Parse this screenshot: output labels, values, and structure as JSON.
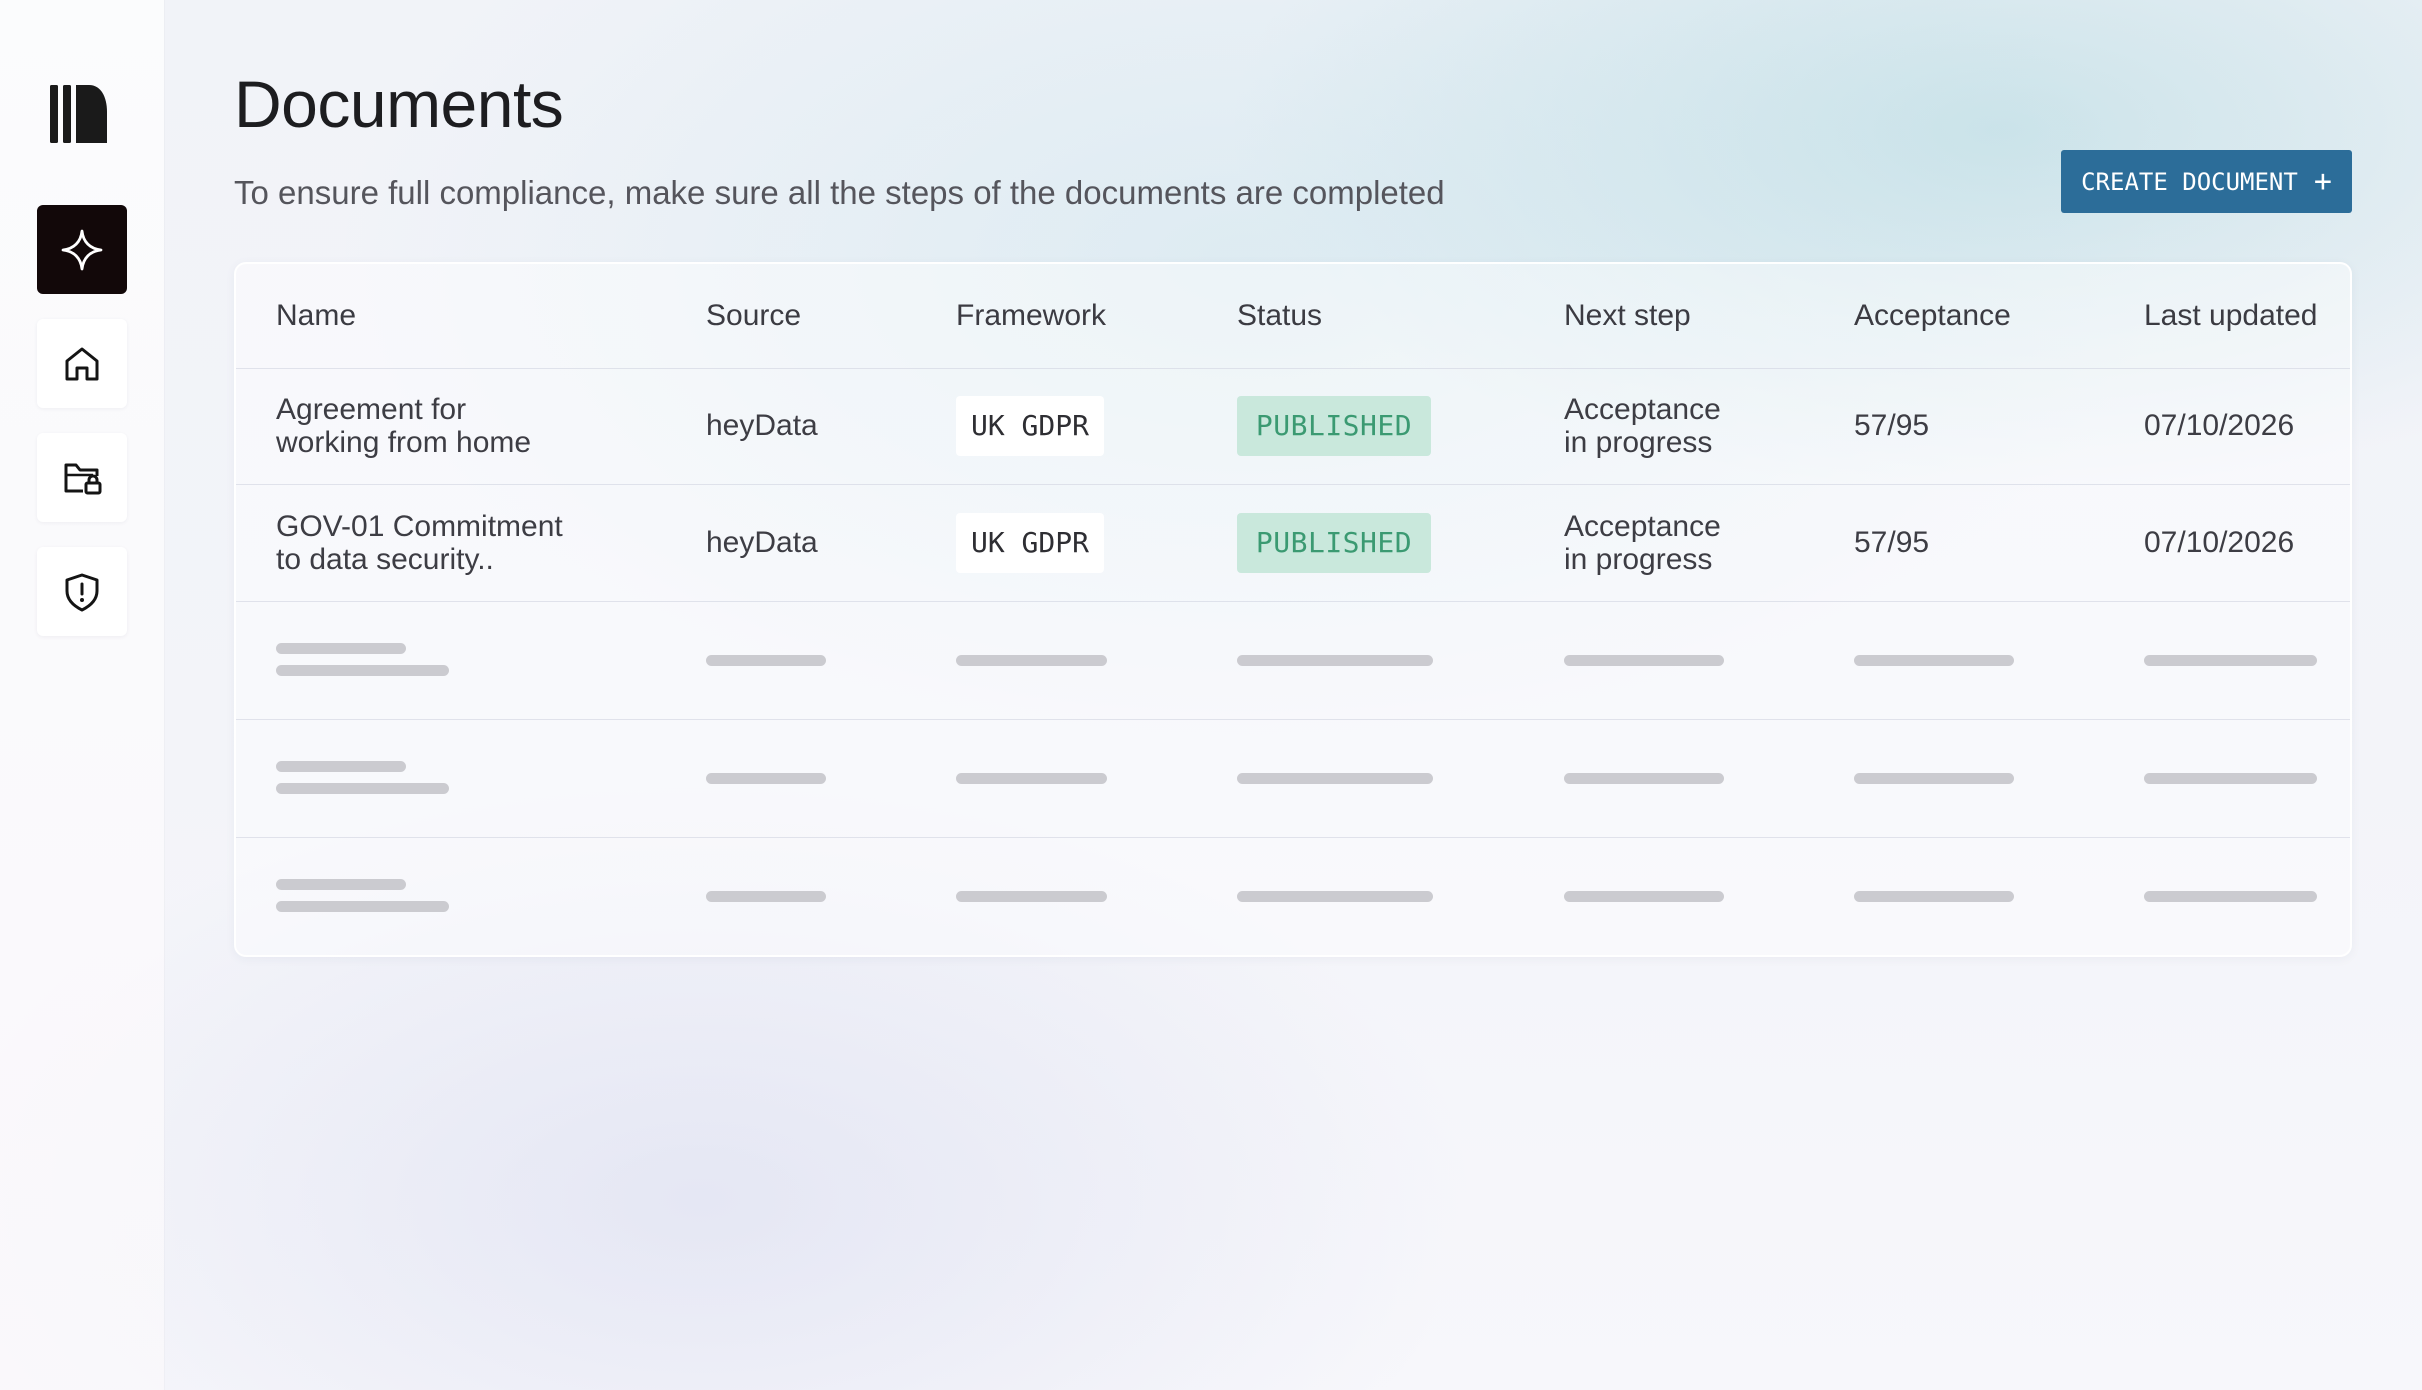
{
  "sidebar": {
    "items": [
      {
        "name": "sparkle",
        "active": true
      },
      {
        "name": "home",
        "active": false
      },
      {
        "name": "documents-folder-lock",
        "active": false
      },
      {
        "name": "security-shield",
        "active": false
      }
    ]
  },
  "page": {
    "title": "Documents",
    "subtitle": "To ensure full compliance, make sure all the steps of the documents are completed",
    "create_button_label": "CREATE DOCUMENT",
    "create_button_icon": "+"
  },
  "table": {
    "headers": [
      "Name",
      "Source",
      "Framework",
      "Status",
      "Next step",
      "Acceptance",
      "Last updated"
    ],
    "rows": [
      {
        "name_line1": "Agreement for",
        "name_line2": "working from home",
        "source": "heyData",
        "framework": "UK GDPR",
        "status": "PUBLISHED",
        "next_line1": "Acceptance",
        "next_line2": "in progress",
        "acceptance": "57/95",
        "last_updated": "07/10/2026"
      },
      {
        "name_line1": "GOV-01 Commitment",
        "name_line2": "to data security..",
        "source": "heyData",
        "framework": "UK GDPR",
        "status": "PUBLISHED",
        "next_line1": "Acceptance",
        "next_line2": "in progress",
        "acceptance": "57/95",
        "last_updated": "07/10/2026"
      }
    ],
    "loading_rows": 3
  },
  "colors": {
    "primary_button": "#2c6d99",
    "status_published_bg": "#c9e8dc",
    "status_published_text": "#3b9a72",
    "active_nav": "#120809",
    "skeleton": "#cbcbd0"
  }
}
